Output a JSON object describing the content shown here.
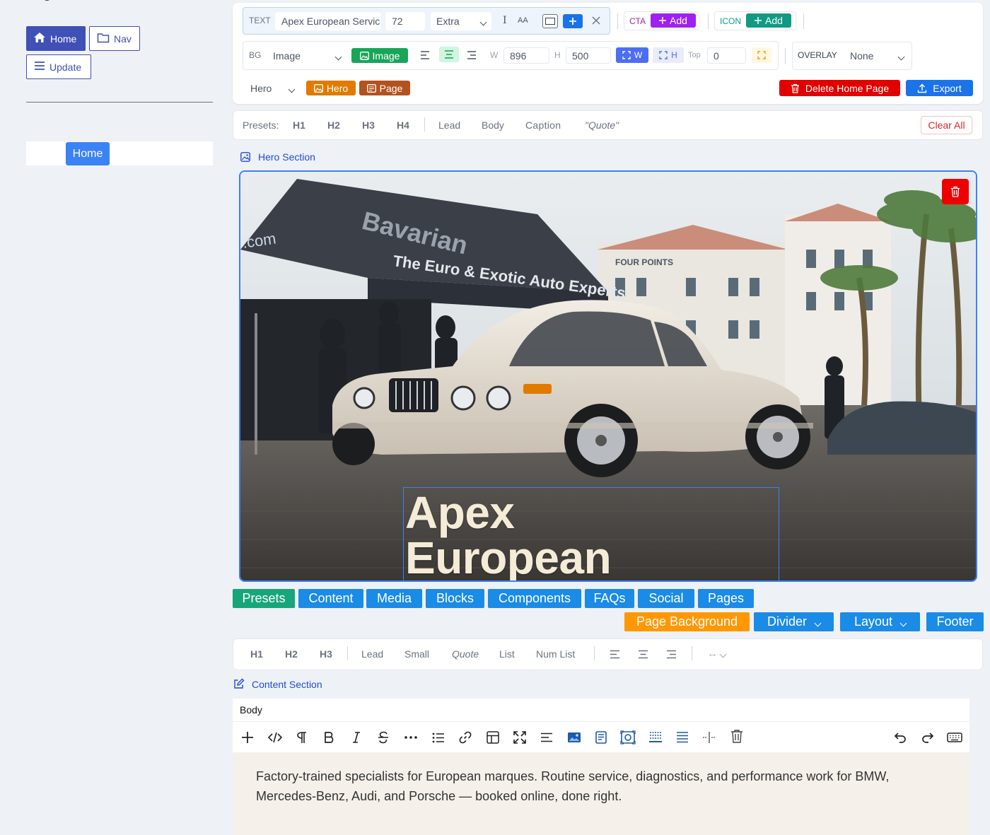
{
  "sidebar": {
    "home_label": "Home",
    "nav_label": "Nav",
    "update_label": "Update",
    "chip_label": "Home"
  },
  "toolbar": {
    "text_label": "TEXT",
    "text_value": "Apex European Servic",
    "size_value": "72",
    "weight_value": "Extra",
    "cursor_glyph": "I",
    "case_label": "AA",
    "cta_label": "CTA",
    "cta_add": "Add",
    "icon_label": "ICON",
    "icon_add": "Add",
    "bg_label": "BG",
    "bg_select": "Image",
    "bg_button": "Image",
    "w_label": "W",
    "w_value": "896",
    "h_label": "H",
    "h_value": "500",
    "fit_w": "W",
    "fit_h": "H",
    "top_label": "Top",
    "top_value": "0",
    "overlay_label": "OVERLAY",
    "overlay_value": "None",
    "section_select": "Hero",
    "hero_button": "Hero",
    "page_button": "Page",
    "delete_home": "Delete Home Page",
    "export": "Export"
  },
  "presets_bar": {
    "label": "Presets:",
    "items": [
      "H1",
      "H2",
      "H3",
      "H4",
      "Lead",
      "Body",
      "Caption",
      "\"Quote\""
    ],
    "clear_all": "Clear All"
  },
  "hero_section": {
    "title": "Hero Section",
    "headline_line1": "Apex",
    "headline_line2": "European Service"
  },
  "tabs": {
    "row1": [
      "Presets",
      "Content",
      "Media",
      "Blocks",
      "Components",
      "FAQs",
      "Social",
      "Pages"
    ],
    "page_background": "Page Background",
    "divider": "Divider",
    "layout": "Layout",
    "footer": "Footer"
  },
  "format_bar": {
    "items": [
      "H1",
      "H2",
      "H3",
      "Lead",
      "Small",
      "Quote",
      "List",
      "Num List"
    ],
    "spacing_glyph": "↔"
  },
  "content_section": {
    "title": "Content Section",
    "style_select": "Body",
    "body_text": "Factory-trained specialists for European marques. Routine service, diagnostics, and performance work for BMW, Mercedes-Benz, Audi, and Porsche — booked online, done right."
  },
  "colors": {
    "primary": "#3f51b5",
    "blue": "#1a8be6",
    "green_tab": "#17a67a",
    "orange": "#ff9800",
    "purple": "#9c27b0",
    "teal": "#0f9d8a",
    "red": "#e00000",
    "hero_orange": "#e07b00",
    "page_brown": "#b4521f"
  }
}
